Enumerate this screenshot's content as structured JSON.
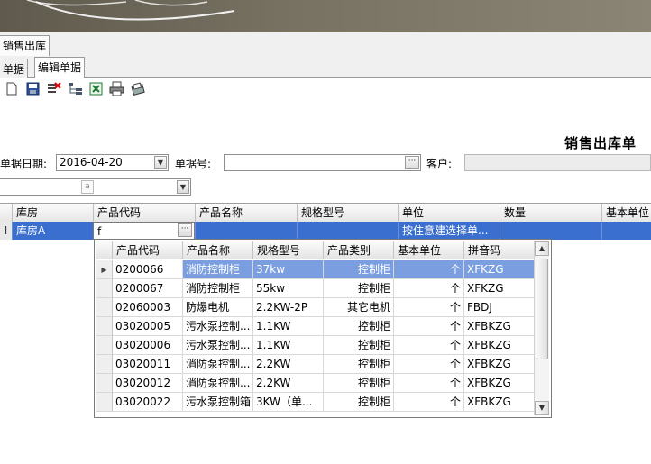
{
  "colors": {
    "selection": "#3a6fd0",
    "popup_selection": "#7b9ee0",
    "banner": "#6f6a5a"
  },
  "tabs": {
    "doc": "销售出库",
    "sub": [
      "单据",
      "编辑单据"
    ]
  },
  "toolbar": {
    "icons": [
      "new-document-icon",
      "save-icon",
      "delete-icon",
      "tree-icon",
      "excel-export-icon",
      "print-icon",
      "print-preview-icon"
    ]
  },
  "form": {
    "title": "销售出库单",
    "date_label": "单据日期:",
    "date_value": "2016-04-20",
    "number_label": "单据号:",
    "number_value": "",
    "customer_label": "客户:",
    "customer_value": "",
    "combo_placeholder": "a"
  },
  "grid": {
    "columns": [
      "库房",
      "产品代码",
      "产品名称",
      "规格型号",
      "单位",
      "数量",
      "基本单位"
    ],
    "row": {
      "marker": "I",
      "warehouse": "库房A",
      "code_input": "f",
      "name": "",
      "spec": "",
      "unit": "按住意建选择单...",
      "qty": "",
      "base_unit": ""
    }
  },
  "popup": {
    "columns": [
      "产品代码",
      "产品名称",
      "规格型号",
      "产品类别",
      "基本单位",
      "拼音码"
    ],
    "rows": [
      {
        "code": "0200066",
        "name": "消防控制柜",
        "spec": "37kw",
        "category": "控制柜",
        "unit": "个",
        "pinyin": "XFKZG"
      },
      {
        "code": "0200067",
        "name": "消防控制柜",
        "spec": "55kw",
        "category": "控制柜",
        "unit": "个",
        "pinyin": "XFKZG"
      },
      {
        "code": "02060003",
        "name": "防爆电机",
        "spec": "2.2KW-2P",
        "category": "其它电机",
        "unit": "个",
        "pinyin": "FBDJ"
      },
      {
        "code": "03020005",
        "name": "污水泵控制...",
        "spec": "1.1KW",
        "category": "控制柜",
        "unit": "个",
        "pinyin": "XFBKZG"
      },
      {
        "code": "03020006",
        "name": "污水泵控制...",
        "spec": "1.1KW",
        "category": "控制柜",
        "unit": "个",
        "pinyin": "XFBKZG"
      },
      {
        "code": "03020011",
        "name": "消防泵控制...",
        "spec": "2.2KW",
        "category": "控制柜",
        "unit": "个",
        "pinyin": "XFBKZG"
      },
      {
        "code": "03020012",
        "name": "消防泵控制...",
        "spec": "2.2KW",
        "category": "控制柜",
        "unit": "个",
        "pinyin": "XFBKZG"
      },
      {
        "code": "03020022",
        "name": "污水泵控制箱",
        "spec": "3KW（单...",
        "category": "控制柜",
        "unit": "个",
        "pinyin": "XFBKZG"
      }
    ]
  }
}
